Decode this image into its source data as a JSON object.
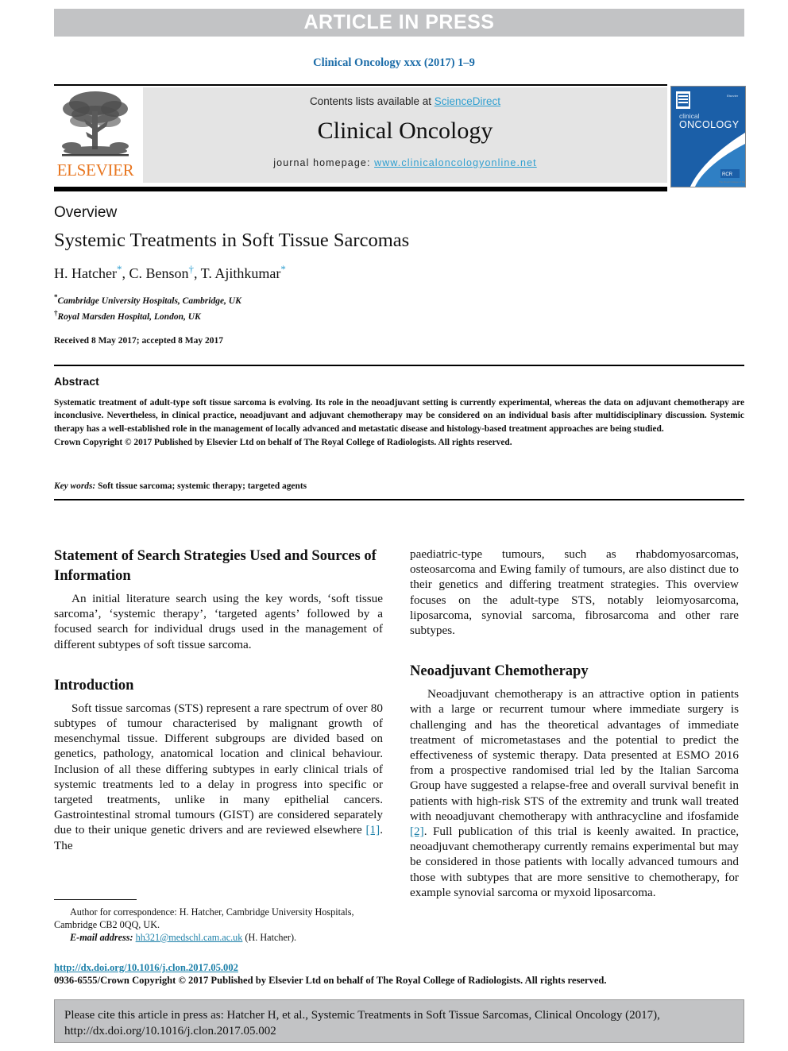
{
  "banner": {
    "label": "ARTICLE IN PRESS",
    "background": "#c2c3c5",
    "text_color": "#ffffff"
  },
  "running_head": "Clinical Oncology xxx (2017) 1–9",
  "masthead": {
    "contents_prefix": "Contents lists available at ",
    "sciencedirect": "ScienceDirect",
    "journal_name": "Clinical Oncology",
    "homepage_prefix": "journal homepage: ",
    "homepage_url": "www.clinicaloncologyonline.net",
    "publisher_wordmark": "ELSEVIER",
    "publisher_color": "#e87722",
    "link_color": "#2f9fd0",
    "cover": {
      "title_line1": "clinical",
      "title_line2": "ONCOLOGY",
      "brand_color": "#1b5fa8"
    }
  },
  "article": {
    "type": "Overview",
    "title": "Systemic Treatments in Soft Tissue Sarcomas",
    "authors": "H. Hatcher *, C. Benson †, T. Ajithkumar *",
    "author_parts": [
      {
        "name": "H. Hatcher",
        "mark": "*"
      },
      {
        "name": "C. Benson",
        "mark": "†"
      },
      {
        "name": "T. Ajithkumar",
        "mark": "*"
      }
    ],
    "affiliations": [
      {
        "mark": "*",
        "text": "Cambridge University Hospitals, Cambridge, UK"
      },
      {
        "mark": "†",
        "text": "Royal Marsden Hospital, London, UK"
      }
    ],
    "history": "Received 8 May 2017; accepted 8 May 2017"
  },
  "abstract": {
    "heading": "Abstract",
    "body": "Systematic treatment of adult-type soft tissue sarcoma is evolving. Its role in the neoadjuvant setting is currently experimental, whereas the data on adjuvant chemotherapy are inconclusive. Nevertheless, in clinical practice, neoadjuvant and adjuvant chemotherapy may be considered on an individual basis after multidisciplinary discussion. Systemic therapy has a well-established role in the management of locally advanced and metastatic disease and histology-based treatment approaches are being studied.",
    "copyright": "Crown Copyright © 2017 Published by Elsevier Ltd on behalf of The Royal College of Radiologists. All rights reserved.",
    "keywords_label": "Key words:",
    "keywords_value": " Soft tissue sarcoma; systemic therapy; targeted agents"
  },
  "sections": {
    "search_strategy": {
      "heading": "Statement of Search Strategies Used and Sources of Information",
      "paragraph": "An initial literature search using the key words, ‘soft tissue sarcoma’, ‘systemic therapy’, ‘targeted agents’ followed by a focused search for individual drugs used in the management of different subtypes of soft tissue sarcoma."
    },
    "introduction": {
      "heading": "Introduction",
      "paragraph_part1": "Soft tissue sarcomas (STS) represent a rare spectrum of over 80 subtypes of tumour characterised by malignant growth of mesenchymal tissue. Different subgroups are divided based on genetics, pathology, anatomical location and clinical behaviour. Inclusion of all these differing subtypes in early clinical trials of systemic treatments led to a delay in progress into specific or targeted treatments, unlike in many epithelial cancers. Gastrointestinal stromal tumours (GIST) are considered separately due to their unique genetic drivers and are reviewed elsewhere ",
      "citation1": "[1]",
      "paragraph_part2": ". The",
      "continuation": "paediatric-type tumours, such as rhabdomyosarcomas, osteosarcoma and Ewing family of tumours, are also distinct due to their genetics and differing treatment strategies. This overview focuses on the adult-type STS, notably leiomyosarcoma, liposarcoma, synovial sarcoma, fibrosarcoma and other rare subtypes."
    },
    "neoadjuvant": {
      "heading": "Neoadjuvant Chemotherapy",
      "paragraph_part1": "Neoadjuvant chemotherapy is an attractive option in patients with a large or recurrent tumour where immediate surgery is challenging and has the theoretical advantages of immediate treatment of micrometastases and the potential to predict the effectiveness of systemic therapy. Data presented at ESMO 2016 from a prospective randomised trial led by the Italian Sarcoma Group have suggested a relapse-free and overall survival benefit in patients with high-risk STS of the extremity and trunk wall treated with neoadjuvant chemotherapy with anthracycline and ifosfamide ",
      "citation2": "[2]",
      "paragraph_part2": ". Full publication of this trial is keenly awaited. In practice, neoadjuvant chemotherapy currently remains experimental but may be considered in those patients with locally advanced tumours and those with subtypes that are more sensitive to chemotherapy, for example synovial sarcoma or myxoid liposarcoma."
    }
  },
  "footnote": {
    "correspondence": "Author for correspondence: H. Hatcher, Cambridge University Hospitals, Cambridge CB2 0QQ, UK.",
    "email_label": "E-mail address:",
    "email": "hh321@medschl.cam.ac.uk",
    "email_suffix": " (H. Hatcher)."
  },
  "doi_block": {
    "doi_url": "http://dx.doi.org/10.1016/j.clon.2017.05.002",
    "issn_line": "0936-6555/Crown Copyright © 2017 Published by Elsevier Ltd on behalf of The Royal College of Radiologists. All rights reserved."
  },
  "cite_box": {
    "text": "Please cite this article in press as: Hatcher H, et al., Systemic Treatments in Soft Tissue Sarcomas, Clinical Oncology (2017), http://dx.doi.org/10.1016/j.clon.2017.05.002",
    "background": "#c2c3c5"
  }
}
